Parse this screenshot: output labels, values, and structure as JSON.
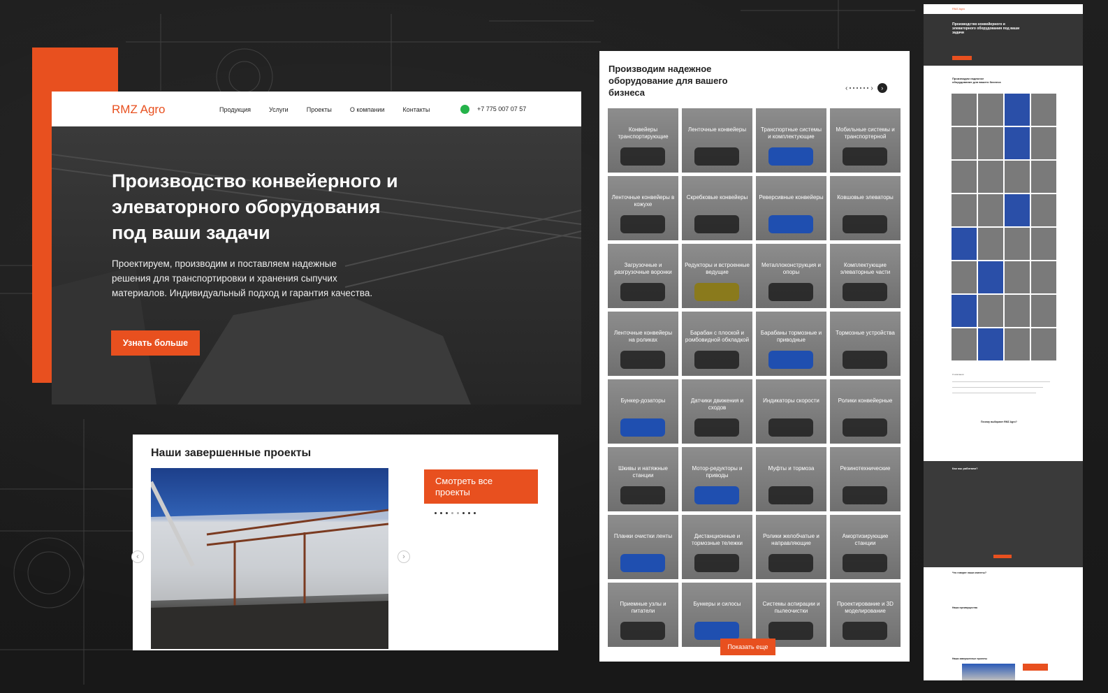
{
  "colors": {
    "accent": "#e8501f",
    "background": "#1b1b1b",
    "whatsapp": "#25b34a"
  },
  "hero": {
    "logo": "RMZ Agro",
    "nav": [
      "Продукция",
      "Услуги",
      "Проекты",
      "О компании",
      "Контакты"
    ],
    "phone_icon": "whatsapp-icon",
    "phone": "+7 775 007 07 57",
    "title": "Производство конвейерного и элеваторного оборудования под ваши задачи",
    "subtitle": "Проектируем, производим и поставляем надежные решения для транспортировки и хранения сыпучих материалов. Индивидуальный подход и гарантия качества.",
    "button": "Узнать больше"
  },
  "projects": {
    "title": "Наши завершенные проекты",
    "button": "Смотреть все проекты",
    "prev_icon": "chevron-left-icon",
    "next_icon": "chevron-right-icon",
    "prev": "‹",
    "next": "›"
  },
  "products": {
    "title": "Производим надежное оборудование для вашего бизнеса",
    "nav_prev": "‹",
    "nav_next": "›",
    "items": [
      {
        "label": "Конвейеры транспортирующие",
        "tone": "dark"
      },
      {
        "label": "Ленточные конвейеры",
        "tone": "dark"
      },
      {
        "label": "Транспортные системы и комплектующие",
        "tone": "blue"
      },
      {
        "label": "Мобильные системы и транспортерной",
        "tone": "dark"
      },
      {
        "label": "Ленточные конвейеры в кожухе",
        "tone": "dark"
      },
      {
        "label": "Скребковые конвейеры",
        "tone": "dark"
      },
      {
        "label": "Реверсивные конвейеры",
        "tone": "blue"
      },
      {
        "label": "Ковшовые элеваторы",
        "tone": "dark"
      },
      {
        "label": "Загрузочные и разгрузочные воронки",
        "tone": "dark"
      },
      {
        "label": "Редукторы и встроенные ведущие",
        "tone": "yellow"
      },
      {
        "label": "Металлоконструкция и опоры",
        "tone": "dark"
      },
      {
        "label": "Комплектующие элеваторные части",
        "tone": "dark"
      },
      {
        "label": "Ленточные конвейеры на роликах",
        "tone": "dark"
      },
      {
        "label": "Барабан с плоской и ромбовидной обкладкой",
        "tone": "dark"
      },
      {
        "label": "Барабаны тормозные и приводные",
        "tone": "blue"
      },
      {
        "label": "Тормозные устройства",
        "tone": "dark"
      },
      {
        "label": "Бункер-дозаторы",
        "tone": "blue"
      },
      {
        "label": "Датчики движения и сходов",
        "tone": "dark"
      },
      {
        "label": "Индикаторы скорости",
        "tone": "dark"
      },
      {
        "label": "Ролики конвейерные",
        "tone": "dark"
      },
      {
        "label": "Шкивы и натяжные станции",
        "tone": "dark"
      },
      {
        "label": "Мотор-редукторы и приводы",
        "tone": "blue"
      },
      {
        "label": "Муфты и тормоза",
        "tone": "dark"
      },
      {
        "label": "Резинотехнические",
        "tone": "dark"
      },
      {
        "label": "Планки очистки ленты",
        "tone": "blue"
      },
      {
        "label": "Дистанционные и тормозные тележки",
        "tone": "dark"
      },
      {
        "label": "Ролики желобчатые и направляющие",
        "tone": "dark"
      },
      {
        "label": "Амортизирующие станции",
        "tone": "dark"
      },
      {
        "label": "Приемные узлы и питатели",
        "tone": "dark"
      },
      {
        "label": "Бункеры и силосы",
        "tone": "blue"
      },
      {
        "label": "Системы аспирации и пылеочистки",
        "tone": "dark"
      },
      {
        "label": "Проектирование и 3D моделирование",
        "tone": "dark"
      }
    ],
    "more_button": "Показать еще"
  },
  "longpage": {
    "logo": "RMZ Agro",
    "hero_title": "Производство конвейерного и элеваторного оборудования под ваши задачи",
    "products_title": "Производим надежное оборудование для вашего бизнеса",
    "about": "О компании",
    "why": "Почему выбирают RMZ Agro?",
    "how": "Как мы работаем?",
    "reviews": "Что говорят наши клиенты?",
    "advantages": "Наши преимущества",
    "projects": "Наши завершенные проекты"
  }
}
